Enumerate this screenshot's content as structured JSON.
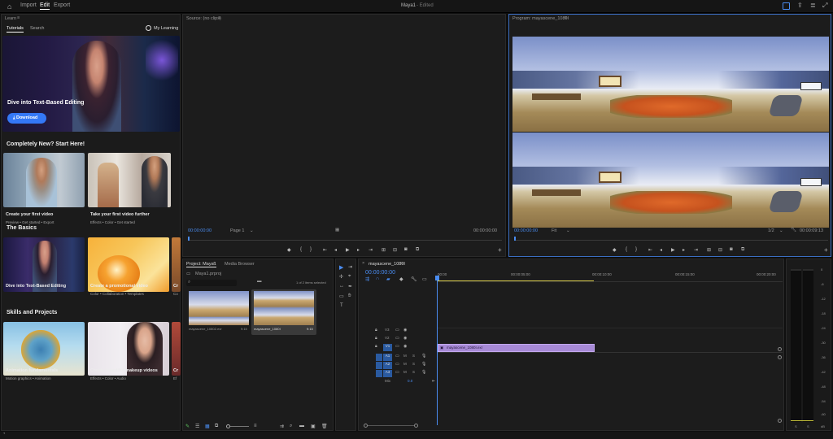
{
  "topbar": {
    "home_icon": "home-icon",
    "tabs": [
      {
        "label": "Import"
      },
      {
        "label": "Edit"
      },
      {
        "label": "Export"
      }
    ],
    "title": "Maya1",
    "title_status": "- Edited"
  },
  "learn": {
    "panel_title": "Learn",
    "tabs": [
      {
        "label": "Tutorials"
      },
      {
        "label": "Search"
      }
    ],
    "my_learning": "My Learning",
    "hero": {
      "title": "Dive into Text-Based Editing",
      "button": "Download"
    },
    "sections": [
      {
        "title": "Completely New? Start Here!",
        "cards": [
          {
            "title": "Create your first video",
            "sub": "Preview • Get started • Export"
          },
          {
            "title": "Take your first video further",
            "sub": "Effects • Color • Get started"
          }
        ]
      },
      {
        "title": "The Basics",
        "cards": [
          {
            "title": "Dive into Text-Based Editing",
            "sub": ""
          },
          {
            "title": "Create a promotional video",
            "sub": "Color • Collaboration • Templates"
          },
          {
            "title": "Cr",
            "sub": "Co"
          }
        ]
      },
      {
        "title": "Skills and Projects",
        "cards": [
          {
            "title": "Animation fundamentals",
            "sub": "Motion graphics • Animation"
          },
          {
            "title": "Create beautiful makeup videos",
            "sub": "Effects • Color • Audio"
          },
          {
            "title": "Cr",
            "sub": "Ef"
          }
        ]
      }
    ]
  },
  "source": {
    "title": "Source: (no clips)",
    "timecode_left": "00:00:00:00",
    "page": "Page 1",
    "timecode_right": "00:00:00:00"
  },
  "program": {
    "title": "Program: mayascene_1080I",
    "timecode_left": "00:00:00:00",
    "fit": "Fit",
    "quality": "1/2",
    "timecode_right": "00:00:09:13"
  },
  "project": {
    "tabs": [
      {
        "label": "Project: Maya1"
      },
      {
        "label": "Media Browser"
      }
    ],
    "bin": "Maya1.prproj",
    "items_selected": "1 of 2 items selected",
    "items": [
      {
        "name": "mayascene_1080Z.exr",
        "duration": "9:15"
      },
      {
        "name": "mayascene_1080I",
        "duration": "9:15"
      }
    ]
  },
  "timeline": {
    "sequence_name": "mayascene_1080I",
    "timecode": "00:00:00:00",
    "ruler": [
      "00:00",
      "00:00:05:00",
      "00:00:10:00",
      "00:00:15:00",
      "00:00:20:00"
    ],
    "video_tracks": [
      "V3",
      "V2",
      "V1"
    ],
    "audio_tracks": [
      "A1",
      "A2",
      "A3"
    ],
    "mix_label": "Mix",
    "mix_value": "0.0",
    "clip_name": "mayascene_1080I.exr"
  },
  "meter": {
    "scale": [
      "0",
      "-6",
      "-12",
      "-18",
      "-24",
      "-30",
      "-36",
      "-42",
      "-48",
      "-54",
      "-60"
    ],
    "bottom": [
      "S",
      "S"
    ],
    "db_label": "dB"
  }
}
